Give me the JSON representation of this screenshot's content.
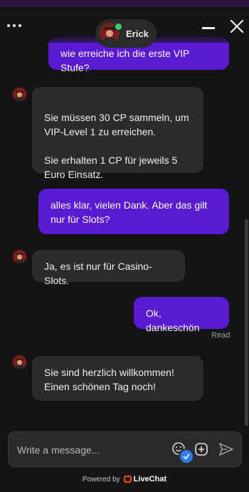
{
  "header": {
    "agent_name": "Erick",
    "icons": [
      "menu-dots-icon",
      "agent-avatar",
      "minimize-icon",
      "close-icon"
    ]
  },
  "messages": [
    {
      "from": "user",
      "text": "wie erreiche ich die erste VIP Stufe?"
    },
    {
      "from": "agent",
      "text": "Sie müssen 30 CP sammeln, um VIP-Level 1 zu erreichen.\n\nSie erhalten 1 CP für jeweils 5 Euro Einsatz."
    },
    {
      "from": "user",
      "text": "alles klar, vielen Dank. Aber das gilt nur für Slots?"
    },
    {
      "from": "agent",
      "text": "Ja, es ist nur für Casino-Slots."
    },
    {
      "from": "user",
      "text": "Ok, dankeschön"
    },
    {
      "from": "agent",
      "text": "Sie sind herzlich willkommen! Einen schönen Tag noch!"
    }
  ],
  "read_receipt": "Read",
  "composer": {
    "placeholder": "Write a message...",
    "icons": [
      "emoji-icon",
      "attach-icon",
      "send-icon"
    ]
  },
  "footer": {
    "powered_by": "Powered by",
    "brand": "LiveChat"
  },
  "colors": {
    "background": "#141414",
    "agent_bubble": "#2b2b2b",
    "user_bubble": "#5a19d2",
    "online": "#2fd16b",
    "badge": "#2f7cf6",
    "brand_logo": "#ff5100"
  }
}
